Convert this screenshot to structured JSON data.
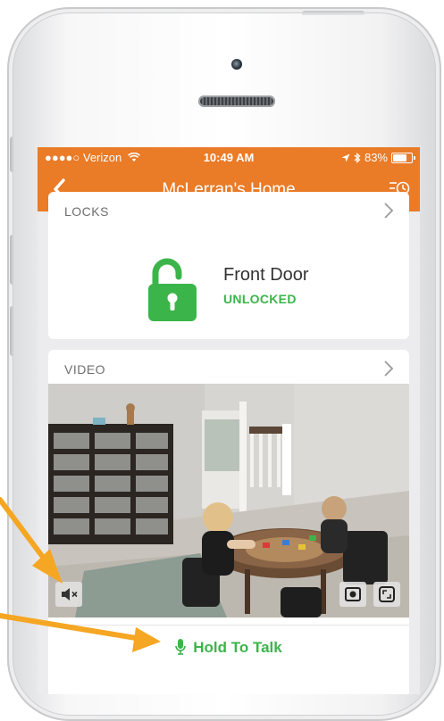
{
  "status_bar": {
    "carrier": "●●●●○ Verizon",
    "time": "10:49 AM",
    "battery": "83%",
    "battery_level": 0.83
  },
  "nav": {
    "title": "McLerran's Home"
  },
  "locks": {
    "header": "LOCKS",
    "door_name": "Front Door",
    "door_status": "UNLOCKED"
  },
  "video": {
    "header": "VIDEO",
    "hold_to_talk": "Hold To Talk"
  },
  "icons": {
    "back": "chevron-left-icon",
    "history": "history-list-icon",
    "lock": "unlocked-padlock-icon",
    "mute": "speaker-muted-icon",
    "snapshot": "camera-snapshot-icon",
    "fullscreen": "expand-icon",
    "mic": "microphone-icon"
  },
  "colors": {
    "brand_orange": "#ea7b27",
    "unlocked_green": "#3bb54a",
    "annotation_arrow": "#f5a623"
  }
}
